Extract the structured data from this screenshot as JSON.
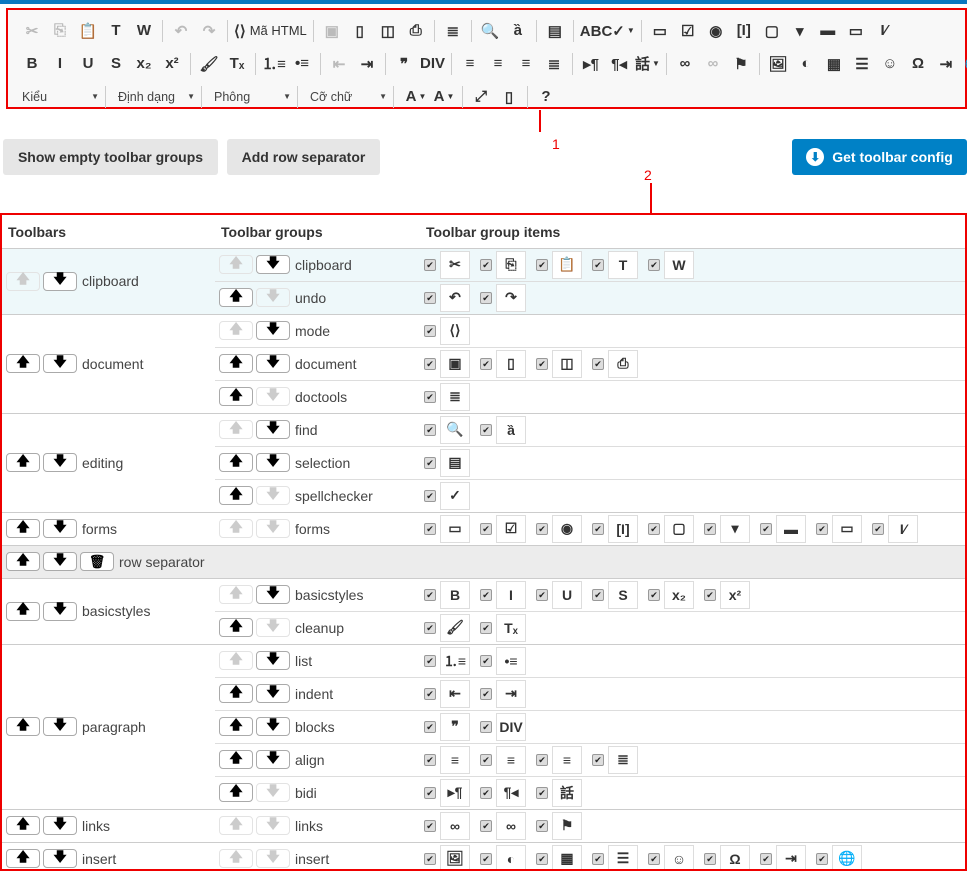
{
  "editor_toolbar": {
    "rows": [
      [
        [
          {
            "icon": "cut-icon",
            "g": "✂",
            "dis": true
          },
          {
            "icon": "copy-icon",
            "g": "⎘",
            "dis": true
          },
          {
            "icon": "paste-icon",
            "g": "📋"
          },
          {
            "icon": "paste-text-icon",
            "g": "T"
          },
          {
            "icon": "paste-word-icon",
            "g": "W"
          }
        ],
        [
          {
            "icon": "undo-icon",
            "g": "↶",
            "dis": true
          },
          {
            "icon": "redo-icon",
            "g": "↷",
            "dis": true
          }
        ],
        [
          {
            "icon": "source-icon",
            "g": "⟨⟩",
            "label": "Mã HTML"
          }
        ],
        [
          {
            "icon": "save-icon",
            "g": "▣",
            "dis": true
          },
          {
            "icon": "new-page-icon",
            "g": "▯"
          },
          {
            "icon": "preview-icon",
            "g": "◫"
          },
          {
            "icon": "print-icon",
            "g": "⎙"
          }
        ],
        [
          {
            "icon": "templates-icon",
            "g": "≣"
          }
        ],
        [
          {
            "icon": "find-icon",
            "g": "🔍"
          },
          {
            "icon": "replace-icon",
            "g": "ȁ"
          }
        ],
        [
          {
            "icon": "select-all-icon",
            "g": "▤"
          }
        ],
        [
          {
            "icon": "spellcheck-icon",
            "g": "ABC✓",
            "dd": true
          }
        ],
        [
          {
            "icon": "form-icon",
            "g": "▭"
          },
          {
            "icon": "checkbox-icon",
            "g": "☑"
          },
          {
            "icon": "radio-icon",
            "g": "◉"
          },
          {
            "icon": "textfield-icon",
            "g": "[I]"
          },
          {
            "icon": "textarea-icon",
            "g": "▢"
          },
          {
            "icon": "select-icon",
            "g": "▾"
          },
          {
            "icon": "button-icon",
            "g": "▬"
          },
          {
            "icon": "imagebutton-icon",
            "g": "▭"
          },
          {
            "icon": "hiddenfield-icon",
            "g": "I⁄"
          }
        ]
      ],
      [
        [
          {
            "icon": "bold-icon",
            "g": "B"
          },
          {
            "icon": "italic-icon",
            "g": "I"
          },
          {
            "icon": "underline-icon",
            "g": "U"
          },
          {
            "icon": "strike-icon",
            "g": "S"
          },
          {
            "icon": "subscript-icon",
            "g": "x₂"
          },
          {
            "icon": "superscript-icon",
            "g": "x²"
          }
        ],
        [
          {
            "icon": "copy-format-icon",
            "g": "🖌"
          },
          {
            "icon": "remove-format-icon",
            "g": "Tₓ"
          }
        ],
        [
          {
            "icon": "numbered-list-icon",
            "g": "⒈≡"
          },
          {
            "icon": "bulleted-list-icon",
            "g": "•≡"
          }
        ],
        [
          {
            "icon": "outdent-icon",
            "g": "⇤",
            "dis": true
          },
          {
            "icon": "indent-icon",
            "g": "⇥"
          }
        ],
        [
          {
            "icon": "blockquote-icon",
            "g": "❞"
          },
          {
            "icon": "div-icon",
            "g": "DIV"
          }
        ],
        [
          {
            "icon": "align-left-icon",
            "g": "≡"
          },
          {
            "icon": "align-center-icon",
            "g": "≡"
          },
          {
            "icon": "align-right-icon",
            "g": "≡"
          },
          {
            "icon": "justify-icon",
            "g": "≣"
          }
        ],
        [
          {
            "icon": "ltr-icon",
            "g": "▸¶"
          },
          {
            "icon": "rtl-icon",
            "g": "¶◂"
          },
          {
            "icon": "language-icon",
            "g": "話",
            "dd": true
          }
        ],
        [
          {
            "icon": "link-icon",
            "g": "∞"
          },
          {
            "icon": "unlink-icon",
            "g": "∞",
            "dis": true
          },
          {
            "icon": "anchor-icon",
            "g": "⚑"
          }
        ],
        [
          {
            "icon": "image-icon",
            "g": "🖼"
          },
          {
            "icon": "flash-icon",
            "g": "◐"
          },
          {
            "icon": "table-icon",
            "g": "▦"
          },
          {
            "icon": "hr-icon",
            "g": "☰"
          },
          {
            "icon": "smiley-icon",
            "g": "☺"
          },
          {
            "icon": "special-char-icon",
            "g": "Ω"
          },
          {
            "icon": "pagebreak-icon",
            "g": "⇥"
          },
          {
            "icon": "iframe-icon",
            "g": "🌐"
          }
        ]
      ]
    ],
    "combos": [
      "Kiểu",
      "Định dạng",
      "Phông",
      "Cỡ chữ"
    ],
    "row3": [
      [
        {
          "icon": "text-color-icon",
          "g": "A",
          "dd": true
        },
        {
          "icon": "bg-color-icon",
          "g": "A",
          "dd": true
        }
      ],
      [
        {
          "icon": "maximize-icon",
          "g": "⤢"
        },
        {
          "icon": "show-blocks-icon",
          "g": "▯"
        }
      ],
      [
        {
          "icon": "help-icon",
          "g": "?"
        }
      ]
    ]
  },
  "annotations": {
    "one": "1",
    "two": "2"
  },
  "buttons": {
    "show_empty": "Show empty toolbar groups",
    "add_sep": "Add row separator",
    "get_config": "Get toolbar config",
    "get_config_icon": "⬇"
  },
  "table": {
    "headers": [
      "Toolbars",
      "Toolbar groups",
      "Toolbar group items"
    ],
    "arrows": {
      "up": "🡅",
      "down": "🡇",
      "trash": "🗑"
    },
    "check": "✔",
    "toolbars": [
      {
        "name": "clipboard",
        "up_dis": true,
        "hl": true,
        "groups": [
          {
            "name": "clipboard",
            "items": [
              {
                "icon": "cut-icon",
                "g": "✂"
              },
              {
                "icon": "copy-icon",
                "g": "⎘"
              },
              {
                "icon": "paste-icon",
                "g": "📋"
              },
              {
                "icon": "paste-text-icon",
                "g": "T"
              },
              {
                "icon": "paste-word-icon",
                "g": "W"
              }
            ]
          },
          {
            "name": "undo",
            "items": [
              {
                "icon": "undo-icon",
                "g": "↶"
              },
              {
                "icon": "redo-icon",
                "g": "↷"
              }
            ]
          }
        ]
      },
      {
        "name": "document",
        "groups": [
          {
            "name": "mode",
            "items": [
              {
                "icon": "source-icon",
                "g": "⟨⟩"
              }
            ]
          },
          {
            "name": "document",
            "items": [
              {
                "icon": "save-icon",
                "g": "▣"
              },
              {
                "icon": "new-page-icon",
                "g": "▯"
              },
              {
                "icon": "preview-icon",
                "g": "◫"
              },
              {
                "icon": "print-icon",
                "g": "⎙"
              }
            ]
          },
          {
            "name": "doctools",
            "items": [
              {
                "icon": "templates-icon",
                "g": "≣"
              }
            ]
          }
        ]
      },
      {
        "name": "editing",
        "groups": [
          {
            "name": "find",
            "items": [
              {
                "icon": "find-icon",
                "g": "🔍"
              },
              {
                "icon": "replace-icon",
                "g": "ȁ"
              }
            ]
          },
          {
            "name": "selection",
            "items": [
              {
                "icon": "select-all-icon",
                "g": "▤"
              }
            ]
          },
          {
            "name": "spellchecker",
            "items": [
              {
                "icon": "spellcheck-icon",
                "g": "✓"
              }
            ]
          }
        ]
      },
      {
        "name": "forms",
        "groups": [
          {
            "name": "forms",
            "items": [
              {
                "icon": "form-icon",
                "g": "▭"
              },
              {
                "icon": "checkbox-icon",
                "g": "☑"
              },
              {
                "icon": "radio-icon",
                "g": "◉"
              },
              {
                "icon": "textfield-icon",
                "g": "[I]"
              },
              {
                "icon": "textarea-icon",
                "g": "▢"
              },
              {
                "icon": "select-icon",
                "g": "▾"
              },
              {
                "icon": "button-icon",
                "g": "▬"
              },
              {
                "icon": "imagebutton-icon",
                "g": "▭"
              },
              {
                "icon": "hiddenfield-icon",
                "g": "I⁄"
              }
            ]
          }
        ]
      },
      {
        "separator": true,
        "name": "row separator"
      },
      {
        "name": "basicstyles",
        "groups": [
          {
            "name": "basicstyles",
            "items": [
              {
                "icon": "bold-icon",
                "g": "B"
              },
              {
                "icon": "italic-icon",
                "g": "I"
              },
              {
                "icon": "underline-icon",
                "g": "U"
              },
              {
                "icon": "strike-icon",
                "g": "S"
              },
              {
                "icon": "subscript-icon",
                "g": "x₂"
              },
              {
                "icon": "superscript-icon",
                "g": "x²"
              }
            ]
          },
          {
            "name": "cleanup",
            "items": [
              {
                "icon": "copy-format-icon",
                "g": "🖌"
              },
              {
                "icon": "remove-format-icon",
                "g": "Tₓ"
              }
            ]
          }
        ]
      },
      {
        "name": "paragraph",
        "groups": [
          {
            "name": "list",
            "items": [
              {
                "icon": "numbered-list-icon",
                "g": "⒈≡"
              },
              {
                "icon": "bulleted-list-icon",
                "g": "•≡"
              }
            ]
          },
          {
            "name": "indent",
            "items": [
              {
                "icon": "outdent-icon",
                "g": "⇤"
              },
              {
                "icon": "indent-icon",
                "g": "⇥"
              }
            ]
          },
          {
            "name": "blocks",
            "items": [
              {
                "icon": "blockquote-icon",
                "g": "❞"
              },
              {
                "icon": "div-icon",
                "g": "DIV"
              }
            ]
          },
          {
            "name": "align",
            "items": [
              {
                "icon": "align-left-icon",
                "g": "≡"
              },
              {
                "icon": "align-center-icon",
                "g": "≡"
              },
              {
                "icon": "align-right-icon",
                "g": "≡"
              },
              {
                "icon": "justify-icon",
                "g": "≣"
              }
            ]
          },
          {
            "name": "bidi",
            "items": [
              {
                "icon": "ltr-icon",
                "g": "▸¶"
              },
              {
                "icon": "rtl-icon",
                "g": "¶◂"
              },
              {
                "icon": "language-icon",
                "g": "話"
              }
            ]
          }
        ]
      },
      {
        "name": "links",
        "groups": [
          {
            "name": "links",
            "items": [
              {
                "icon": "link-icon",
                "g": "∞"
              },
              {
                "icon": "unlink-icon",
                "g": "∞"
              },
              {
                "icon": "anchor-icon",
                "g": "⚑"
              }
            ]
          }
        ]
      },
      {
        "name": "insert",
        "groups": [
          {
            "name": "insert",
            "items": [
              {
                "icon": "image-icon",
                "g": "🖼"
              },
              {
                "icon": "flash-icon",
                "g": "◐"
              },
              {
                "icon": "table-icon",
                "g": "▦"
              },
              {
                "icon": "hr-icon",
                "g": "☰"
              },
              {
                "icon": "smiley-icon",
                "g": "☺"
              },
              {
                "icon": "special-char-icon",
                "g": "Ω"
              },
              {
                "icon": "pagebreak-icon",
                "g": "⇥"
              },
              {
                "icon": "iframe-icon",
                "g": "🌐"
              }
            ]
          }
        ]
      }
    ]
  }
}
